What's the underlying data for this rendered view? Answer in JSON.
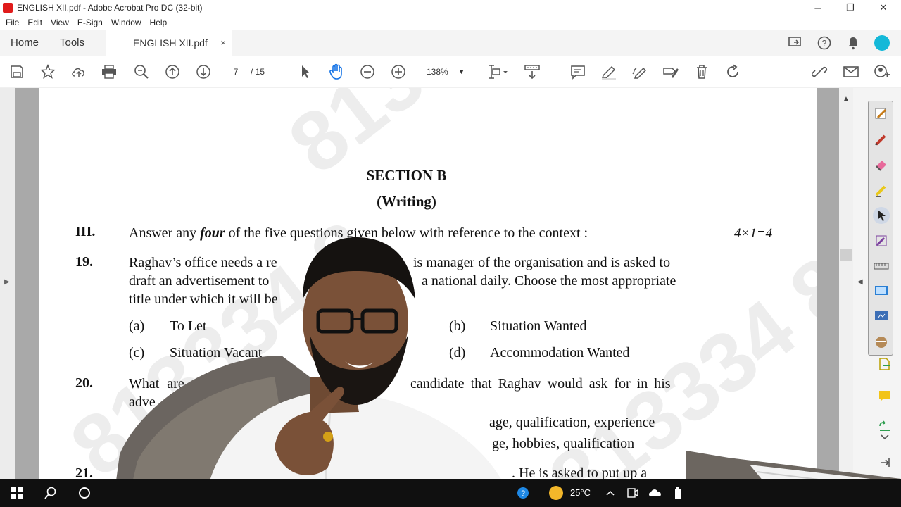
{
  "window": {
    "title": "ENGLISH XII.pdf - Adobe Acrobat Pro DC (32-bit)",
    "minimize": "─",
    "restore": "❐",
    "close": "✕"
  },
  "menu": [
    "File",
    "Edit",
    "View",
    "E-Sign",
    "Window",
    "Help"
  ],
  "tabs": {
    "home": "Home",
    "tools": "Tools",
    "document": "ENGLISH XII.pdf",
    "close": "×"
  },
  "toolbar": {
    "current_page": "7",
    "total_pages": "/ 15",
    "zoom": "138%"
  },
  "document": {
    "watermark": "813334 8",
    "section_title": "SECTION B",
    "section_subtitle": "(Writing)",
    "instruction_num": "III.",
    "instruction_text_pre": "Answer any ",
    "instruction_emph": "four",
    "instruction_text_post": " of the five questions given below with reference to the context :",
    "marks": "4×1=4",
    "q19_num": "19.",
    "q19_line1": "Raghav’s office needs a re",
    "q19_line1b": "is manager of the organisation and is asked to",
    "q19_line2": "draft an advertisement to",
    "q19_line2b": "a national daily. Choose the most appropriate",
    "q19_line3": "title under which it will be",
    "q19_opt_a_label": "(a)",
    "q19_opt_a": "To Let",
    "q19_opt_b_label": "(b)",
    "q19_opt_b": "Situation Wanted",
    "q19_opt_c_label": "(c)",
    "q19_opt_c": "Situation Vacant",
    "q19_opt_d_label": "(d)",
    "q19_opt_d": "Accommodation Wanted",
    "q20_num": "20.",
    "q20_line1": "What are the",
    "q20_line1b": "candidate that Raghav would ask for in his",
    "q20_line2": "adve",
    "q20_opt1": "age, qualification, experience",
    "q20_opt2": "ge, hobbies, qualification",
    "q21_num": "21.",
    "q21_text": ". He is asked to put up a"
  },
  "taskbar": {
    "temperature": "25°C"
  }
}
